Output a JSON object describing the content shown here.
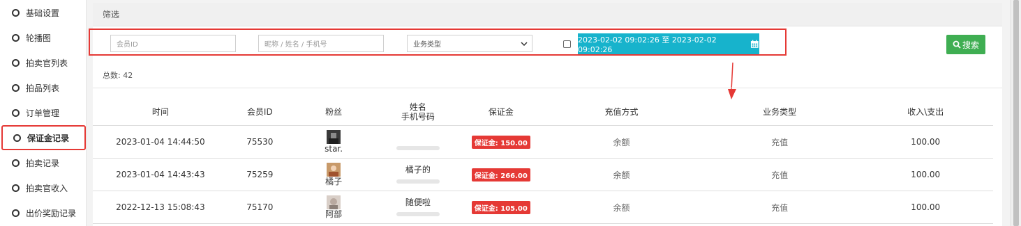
{
  "sidebar": {
    "items": [
      {
        "label": "基础设置"
      },
      {
        "label": "轮播图"
      },
      {
        "label": "拍卖官列表"
      },
      {
        "label": "拍品列表"
      },
      {
        "label": "订单管理"
      },
      {
        "label": "保证金记录"
      },
      {
        "label": "拍卖记录"
      },
      {
        "label": "拍卖官收入"
      },
      {
        "label": "出价奖励记录"
      }
    ]
  },
  "filter": {
    "title": "筛选",
    "member_id_placeholder": "会员ID",
    "name_placeholder": "昵称 / 姓名 / 手机号",
    "business_type_selected": "业务类型",
    "date_range": "2023-02-02 09:02:26 至 2023-02-02 09:02:26",
    "search_label": "搜索",
    "colors": {
      "date": "#17b3cc",
      "search": "#3fae52",
      "highlight": "#e53935"
    }
  },
  "summary": {
    "total_label": "总数: 42"
  },
  "table": {
    "headers": [
      "时间",
      "会员ID",
      "粉丝",
      "姓名",
      "手机号码",
      "保证金",
      "充值方式",
      "业务类型",
      "收入\\支出"
    ],
    "rows": [
      {
        "time": "2023-01-04 14:44:50",
        "member_id": "75530",
        "fan": "star.",
        "name": "",
        "deposit": "保证金: 150.00",
        "method": "余额",
        "type": "充值",
        "amount": "100.00"
      },
      {
        "time": "2023-01-04 14:43:43",
        "member_id": "75259",
        "fan": "橘子",
        "name": "橘子的",
        "deposit": "保证金: 266.00",
        "method": "余额",
        "type": "充值",
        "amount": "100.00"
      },
      {
        "time": "2022-12-13 15:08:43",
        "member_id": "75170",
        "fan": "阿部",
        "name": "随便啦",
        "deposit": "保证金: 105.00",
        "method": "余额",
        "type": "充值",
        "amount": "100.00"
      }
    ]
  }
}
